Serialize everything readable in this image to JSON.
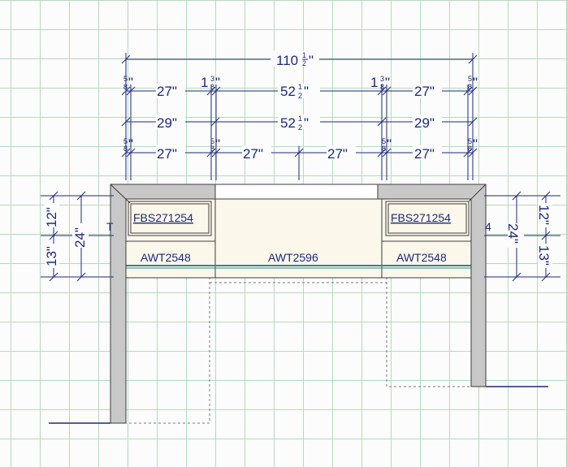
{
  "dims": {
    "inch": "\"",
    "overall": {
      "whole": "110",
      "num": "1",
      "den": "2"
    },
    "row1": {
      "a_num": "5",
      "a_den": "8",
      "b": "27\"",
      "c_whole": "1",
      "c_num": "3",
      "c_den": "8",
      "d_whole": "52",
      "d_num": "1",
      "d_den": "2",
      "e_whole": "1",
      "e_num": "3",
      "e_den": "8",
      "f": "27\"",
      "g_num": "5",
      "g_den": "8"
    },
    "row2": {
      "a": "29\"",
      "b_whole": "52",
      "b_num": "1",
      "b_den": "2",
      "c": "29\""
    },
    "row3": {
      "a_num": "5",
      "a_den": "8",
      "b": "27\"",
      "c_num": "5",
      "c_den": "8",
      "d": "27\"",
      "e": "27\"",
      "f_num": "5",
      "f_den": "8",
      "g": "27\"",
      "h_num": "5",
      "h_den": "8"
    },
    "side": {
      "twelve": "12\"",
      "thirteen": "13\"",
      "twentyfour": "24\""
    }
  },
  "labels": {
    "fbs": "FBS271254",
    "awt2548": "AWT2548",
    "awt2596": "AWT2596",
    "left_fragment": "T",
    "right_fragment": "4"
  }
}
